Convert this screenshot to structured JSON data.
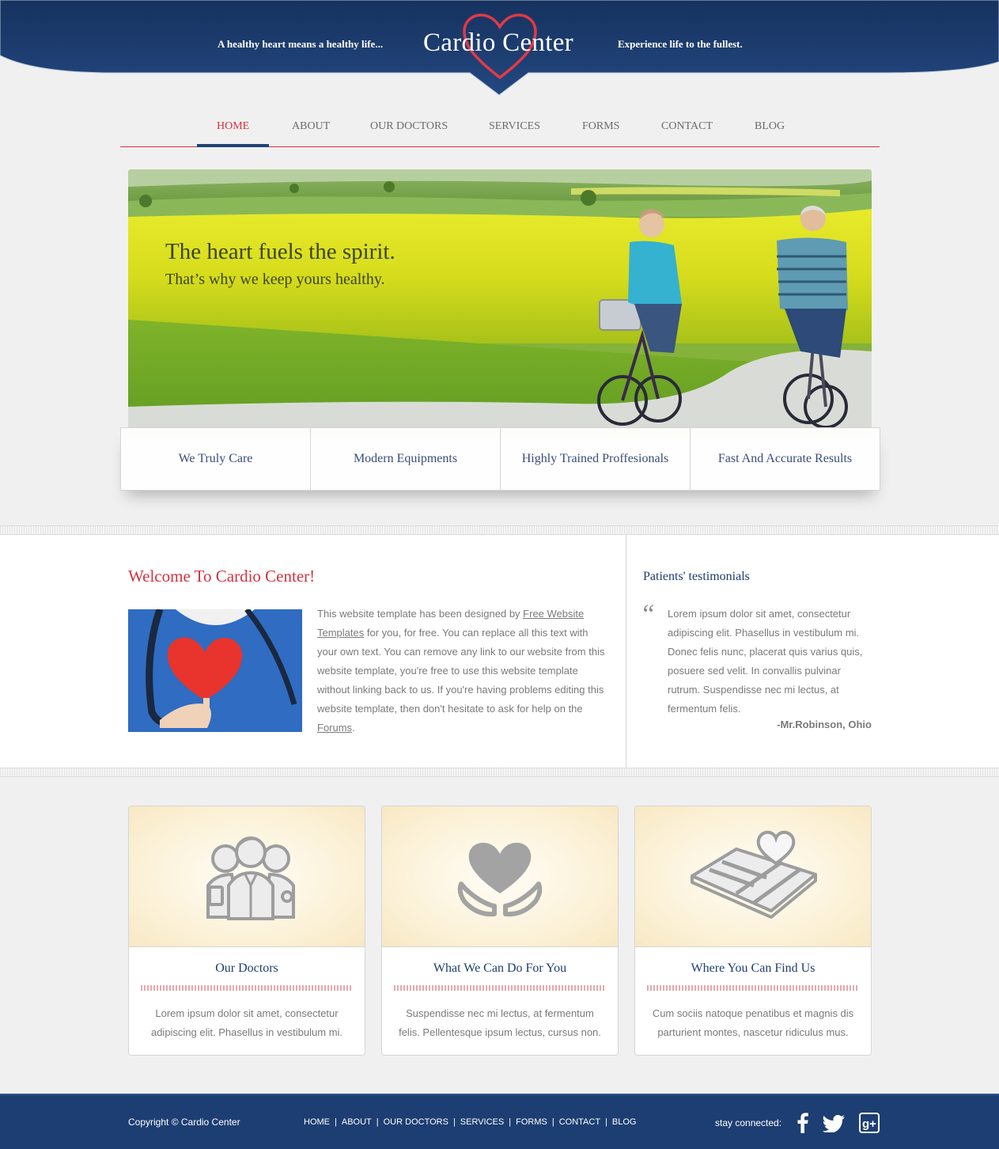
{
  "header": {
    "tagline_left": "A healthy heart means a healthy life...",
    "logo": "Cardio Center",
    "tagline_right": "Experience life to the fullest."
  },
  "nav": {
    "items": [
      "HOME",
      "ABOUT",
      "OUR DOCTORS",
      "SERVICES",
      "FORMS",
      "CONTACT",
      "BLOG"
    ],
    "active": "HOME"
  },
  "hero": {
    "title": "The heart fuels the spirit.",
    "subtitle": "That’s why we keep yours healthy."
  },
  "features": [
    "We Truly Care",
    "Modern Equipments",
    "Highly Trained Proffesionals",
    "Fast And Accurate Results"
  ],
  "welcome": {
    "title": "Welcome To Cardio Center!",
    "text_1": "This website template has been designed by ",
    "link_1": "Free Website Templates",
    "text_2": " for you, for free. You can replace all this text with your own text. You can remove any link to our website from this website template, you're free to use this website template without linking back to us. If you're having problems editing this website template, then don't hesitate to ask for help on the ",
    "link_2": "Forums",
    "text_3": "."
  },
  "testimonials": {
    "title": "Patients' testimonials",
    "quote": "Lorem ipsum dolor sit amet, consectetur adipiscing elit. Phasellus in vestibulum mi. Donec felis nunc, placerat quis varius quis, posuere sed velit. In convallis pulvinar rutrum. Suspendisse nec mi lectus, at fermentum felis.",
    "author": "-Mr.Robinson, Ohio"
  },
  "cards": [
    {
      "title": "Our Doctors",
      "text": "Lorem ipsum dolor sit amet, consectetur adipiscing elit. Phasellus in vestibulum mi.",
      "icon": "doctors-icon"
    },
    {
      "title": "What We Can Do For You",
      "text": "Suspendisse nec mi lectus, at fermentum felis. Pellentesque ipsum lectus, cursus non.",
      "icon": "heart-hands-icon"
    },
    {
      "title": "Where You Can Find Us",
      "text": "Cum sociis natoque penatibus et magnis dis parturient montes, nascetur ridiculus mus.",
      "icon": "map-heart-icon"
    }
  ],
  "footer": {
    "copyright": "Copyright © Cardio Center",
    "links": [
      "HOME",
      "ABOUT",
      "OUR DOCTORS",
      "SERVICES",
      "FORMS",
      "CONTACT",
      "BLOG"
    ],
    "stay_connected": "stay connected:",
    "social": [
      "facebook-icon",
      "twitter-icon",
      "google-plus-icon"
    ]
  },
  "colors": {
    "navy": "#1d3e72",
    "accent_red": "#d2333f",
    "heading_blue": "#1f3c6e"
  }
}
